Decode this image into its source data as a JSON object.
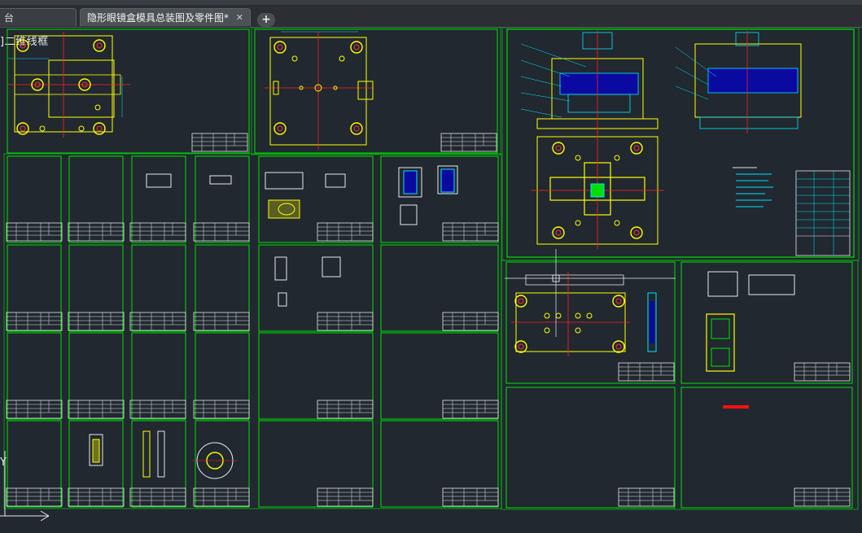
{
  "tabs": {
    "start_label": "台",
    "active_label": "隐形眼镜盒模具总装图及零件图*",
    "close_glyph": "✕",
    "add_glyph": "+"
  },
  "viewport": {
    "label": "]二维线框"
  },
  "axis_letter": "Y",
  "colors": {
    "background": "#212830",
    "frame": "#00e000",
    "title_block": "#e8e8e8",
    "geometry_yellow": "#ffff00",
    "geometry_cyan": "#00e5ff",
    "center_line": "#ff2020",
    "fill_blue": "#0a0aa0",
    "highlight_red": "#ff1010"
  },
  "icons": [
    "close-icon",
    "plus-icon",
    "crosshair-cursor-icon",
    "ucs-icon"
  ]
}
